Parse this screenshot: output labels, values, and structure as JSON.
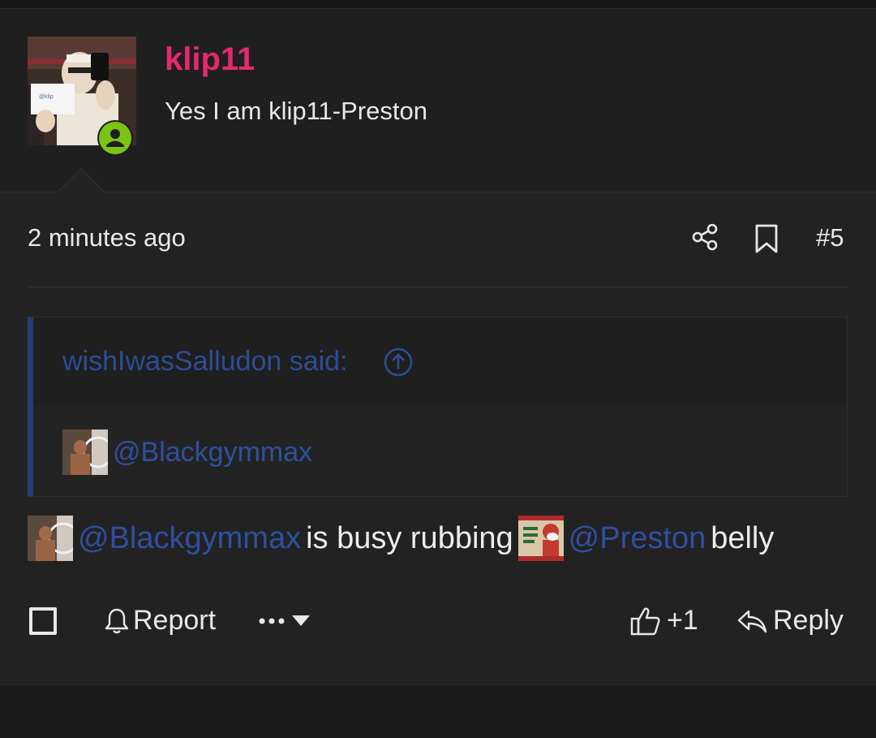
{
  "post": {
    "username": "klip11",
    "user_title": "Yes I am klip11-Preston",
    "timestamp": "2 minutes ago",
    "post_number": "#5",
    "quote": {
      "author_said": "wishIwasSalludon said:",
      "mention": "@Blackgymmax"
    },
    "message": {
      "mention1": "@Blackgymmax",
      "text1": "is busy rubbing",
      "mention2": "@Preston",
      "text2": "belly"
    },
    "actions": {
      "report": "Report",
      "like_count": "+1",
      "reply": "Reply"
    }
  },
  "colors": {
    "username": "#e6286f",
    "mention": "#2f4fa0",
    "quote_bar": "#243c7a",
    "online": "#7bc414"
  },
  "icons": [
    "online-user-icon",
    "share-icon",
    "bookmark-icon",
    "jump-to-quote-icon",
    "bell-icon",
    "ellipsis-icon",
    "caret-down-icon",
    "thumbs-up-icon",
    "reply-arrow-icon"
  ]
}
